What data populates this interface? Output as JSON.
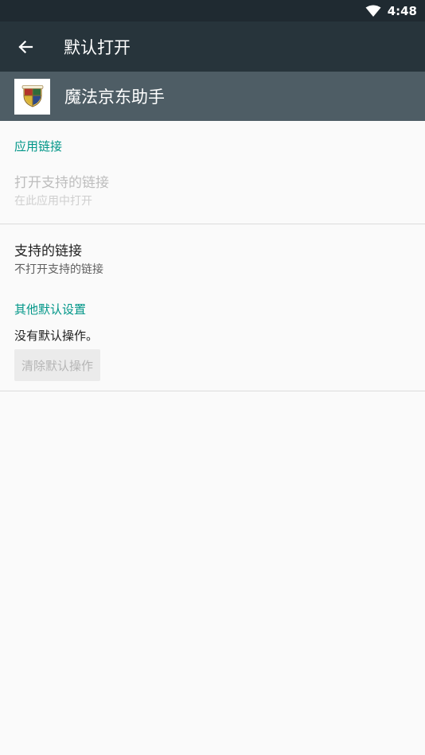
{
  "status_bar": {
    "time": "4:48"
  },
  "toolbar": {
    "title": "默认打开"
  },
  "app": {
    "name": "魔法京东助手"
  },
  "app_links": {
    "header": "应用链接",
    "open_links_title": "打开支持的链接",
    "open_links_summary": "在此应用中打开",
    "supported_links_title": "支持的链接",
    "supported_links_summary": "不打开支持的链接"
  },
  "other_defaults": {
    "header": "其他默认设置",
    "summary": "没有默认操作。",
    "clear_button": "清除默认操作"
  },
  "colors": {
    "status_bar": "#1f2a31",
    "toolbar": "#27343b",
    "app_header": "#4e5d65",
    "accent": "#009688",
    "background": "#fafafa"
  }
}
